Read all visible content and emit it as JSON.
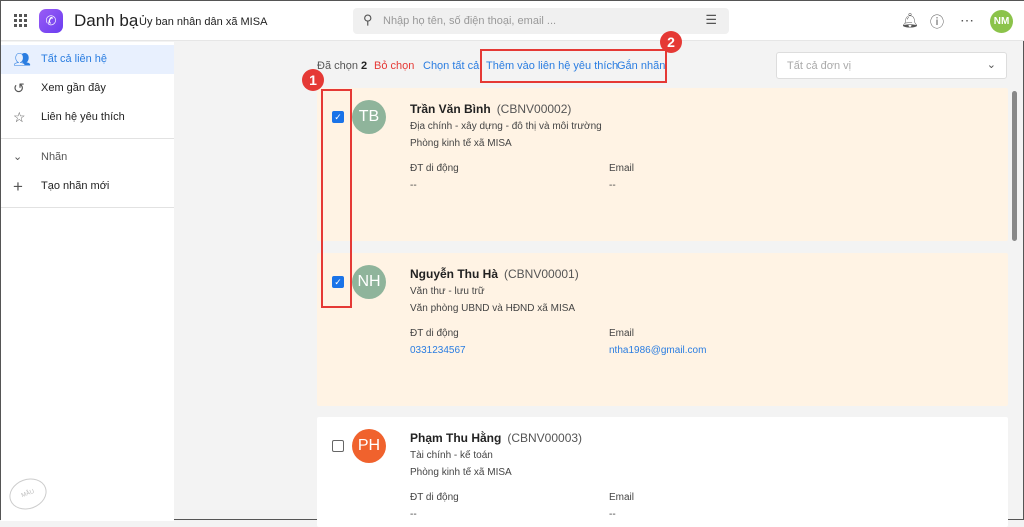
{
  "header": {
    "app_title": "Danh bạ",
    "org": "Ủy ban nhân dân xã MISA",
    "search_placeholder": "Nhập họ tên, số điện thoại, email ...",
    "avatar": "NM"
  },
  "sidebar": {
    "items": [
      {
        "label": "Tất cả liên hệ",
        "icon": "contacts-icon"
      },
      {
        "label": "Xem gần đây",
        "icon": "history-icon"
      },
      {
        "label": "Liên hệ yêu thích",
        "icon": "star-icon"
      },
      {
        "label": "Nhãn",
        "icon": "chevron-down-icon"
      },
      {
        "label": "Tạo nhãn mới",
        "icon": "plus-icon"
      }
    ]
  },
  "toolbar": {
    "selected_label": "Đã chọn",
    "selected_count": "2",
    "deselect": "Bỏ chọn",
    "select_all": "Chọn tất cả",
    "add_favorite": "Thêm vào liên hệ yêu thích",
    "assign_label": "Gắn nhãn",
    "unit_placeholder": "Tất cả đơn vị"
  },
  "annotations": [
    "1",
    "2"
  ],
  "watermark": "DỮ LIỆU MẪU",
  "contacts": [
    {
      "initials": "TB",
      "name": "Trần Văn Bình",
      "code": "(CBNV00002)",
      "title": "Địa chính - xây dựng - đô thị và môi trường",
      "dept": "Phòng kinh tế xã MISA",
      "phone_label": "ĐT di động",
      "phone": "--",
      "email_label": "Email",
      "email": "--",
      "checked": true,
      "color": "#8fb49b"
    },
    {
      "initials": "NH",
      "name": "Nguyễn Thu Hà",
      "code": "(CBNV00001)",
      "title": "Văn thư - lưu trữ",
      "dept": "Văn phòng UBND và HĐND xã MISA",
      "phone_label": "ĐT di động",
      "phone": "0331234567",
      "email_label": "Email",
      "email": "ntha1986@gmail.com",
      "checked": true,
      "color": "#8fb49b"
    },
    {
      "initials": "PH",
      "name": "Phạm Thu Hằng",
      "code": "(CBNV00003)",
      "title": "Tài chính - kế toán",
      "dept": "Phòng kinh tế xã MISA",
      "phone_label": "ĐT di động",
      "phone": "--",
      "email_label": "Email",
      "email": "--",
      "checked": false,
      "color": "#f0622d"
    }
  ]
}
